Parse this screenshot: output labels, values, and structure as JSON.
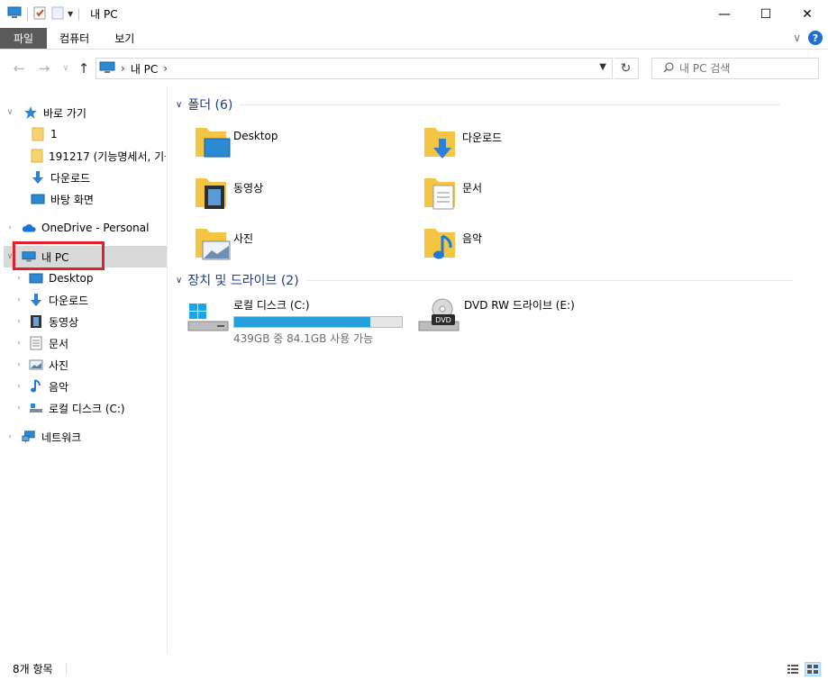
{
  "window": {
    "title": "내 PC",
    "minimize": "—",
    "maximize": "☐",
    "close": "✕"
  },
  "ribbon": {
    "tabs": [
      "파일",
      "컴퓨터",
      "보기"
    ],
    "collapse": "∨",
    "help": "?"
  },
  "navbar": {
    "back": "←",
    "forward": "→",
    "recent": "∨",
    "up": "↑",
    "breadcrumb": "내 PC",
    "refresh": "↻",
    "search_placeholder": "내 PC 검색"
  },
  "nav_pane": {
    "quick_access": "바로 가기",
    "quick_items": [
      "1",
      "191217 (기능명세서, 기능",
      "다운로드",
      "바탕 화면"
    ],
    "onedrive": "OneDrive - Personal",
    "this_pc": "내 PC",
    "pc_items": [
      "Desktop",
      "다운로드",
      "동영상",
      "문서",
      "사진",
      "음악",
      "로컬 디스크 (C:)"
    ],
    "network": "네트워크"
  },
  "content": {
    "folders_header": "폴더 (6)",
    "folders": [
      "Desktop",
      "다운로드",
      "동영상",
      "문서",
      "사진",
      "음악"
    ],
    "devices_header": "장치 및 드라이브 (2)",
    "drives": [
      {
        "name": "로컬 디스크 (C:)",
        "free": "439GB 중 84.1GB 사용 가능",
        "used_fraction": 0.81
      },
      {
        "name": "DVD RW 드라이브 (E:)"
      }
    ]
  },
  "status": {
    "count": "8개 항목"
  },
  "colors": {
    "accent": "#1e3c8c",
    "bar_fill": "#26a0da",
    "highlight": "#e0202a",
    "folder": "#f6c443"
  }
}
